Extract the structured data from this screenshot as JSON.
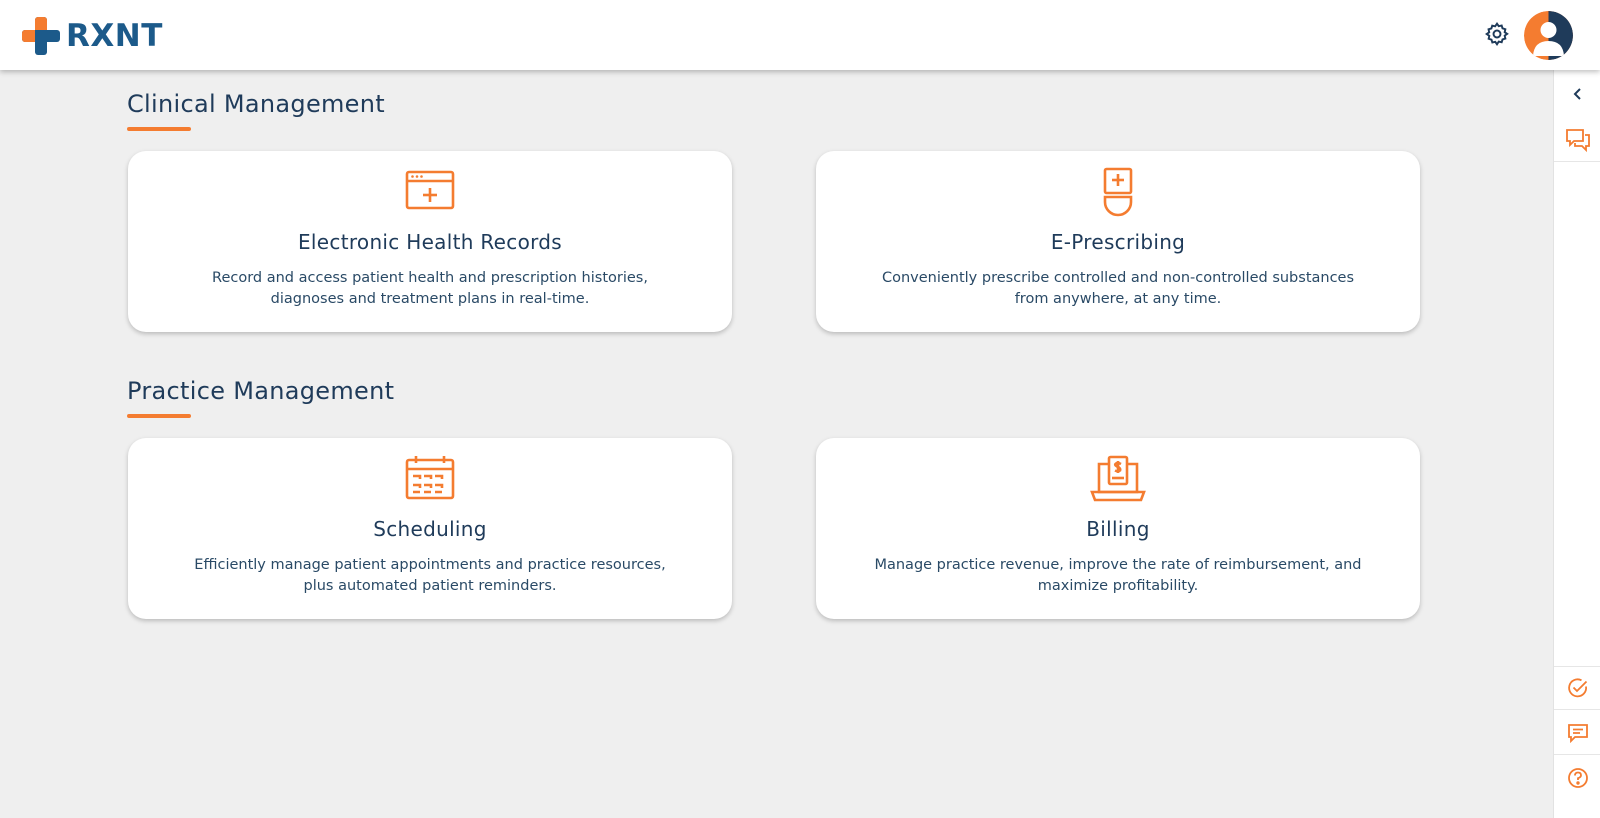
{
  "header": {
    "brand": "RXNT",
    "settings_icon": "gear-icon",
    "avatar_icon": "user-avatar-icon"
  },
  "colors": {
    "accent": "#f47c30",
    "brand_blue": "#1c5a8a",
    "text": "#1f3b5a",
    "background": "#efefef"
  },
  "sections": [
    {
      "title": "Clinical Management",
      "cards": [
        {
          "icon": "health-record-icon",
          "title": "Electronic Health Records",
          "description": "Record and access patient health and prescription histories, diagnoses and treatment plans in real-time."
        },
        {
          "icon": "prescription-icon",
          "title": "E-Prescribing",
          "description": "Conveniently prescribe controlled and non-controlled substances from anywhere, at any time."
        }
      ]
    },
    {
      "title": "Practice Management",
      "cards": [
        {
          "icon": "calendar-icon",
          "title": "Scheduling",
          "description": "Efficiently manage patient appointments and practice resources, plus automated patient reminders."
        },
        {
          "icon": "billing-laptop-icon",
          "title": "Billing",
          "description": "Manage practice revenue, improve the rate of reimbursement, and maximize profitability."
        }
      ]
    }
  ],
  "right_rail": {
    "top": [
      "collapse-chevron-icon",
      "chat-bubbles-icon"
    ],
    "bottom": [
      "check-circle-icon",
      "message-icon",
      "help-icon"
    ]
  }
}
